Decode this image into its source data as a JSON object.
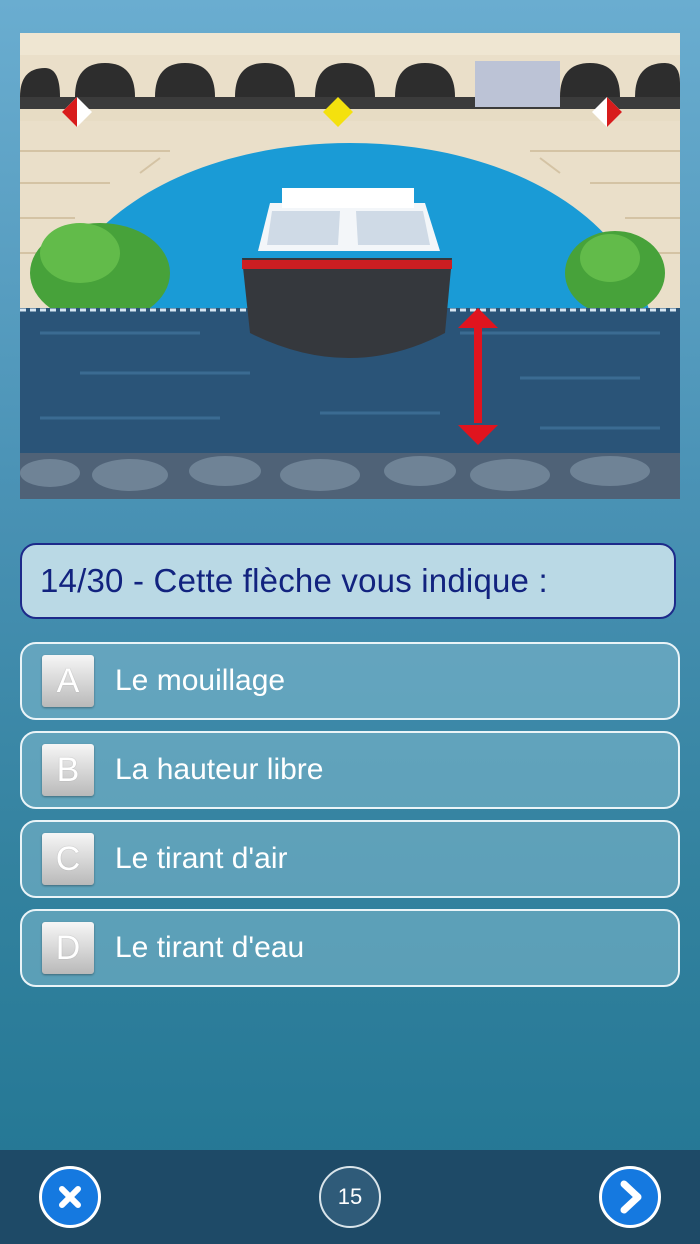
{
  "question": {
    "progress": "14/30",
    "separator": " - ",
    "text": "Cette flèche vous indique :"
  },
  "answers": [
    {
      "letter": "A",
      "label": "Le mouillage"
    },
    {
      "letter": "B",
      "label": "La hauteur libre"
    },
    {
      "letter": "C",
      "label": "Le tirant d'air"
    },
    {
      "letter": "D",
      "label": "Le tirant d'eau"
    }
  ],
  "toolbar": {
    "close_icon": "close-icon",
    "counter": "15",
    "next_icon": "chevron-right-icon"
  },
  "colors": {
    "question_text": "#12237f",
    "button_blue": "#1579e0",
    "arrow_red": "#e0141e"
  }
}
